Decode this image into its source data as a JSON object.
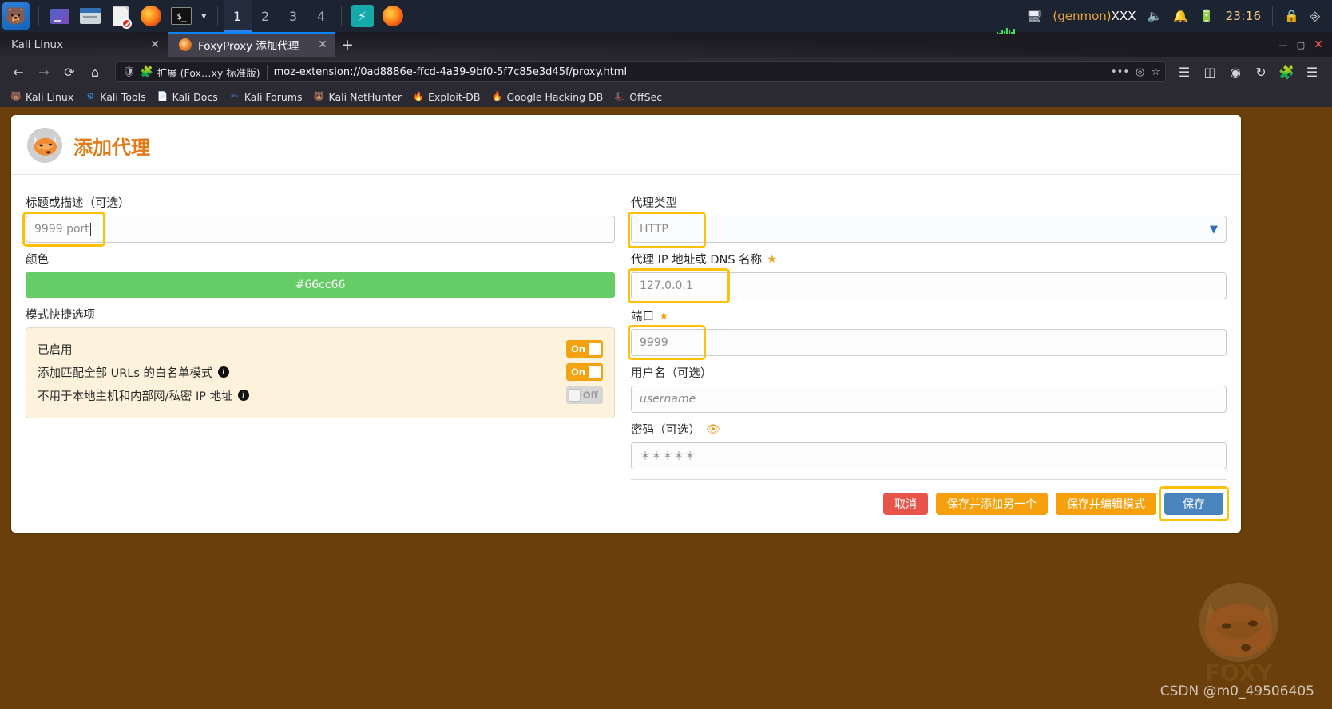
{
  "panel": {
    "launchers": [
      {
        "name": "kali-menu",
        "icon": "kali-dragon-icon"
      },
      {
        "name": "app-gradient",
        "icon": "files-icon"
      },
      {
        "name": "file-manager",
        "icon": "folder-icon"
      },
      {
        "name": "text-editor",
        "icon": "document-icon"
      },
      {
        "name": "firefox",
        "icon": "firefox-icon"
      },
      {
        "name": "terminal",
        "icon": "terminal-icon"
      }
    ],
    "workspaces": [
      "1",
      "2",
      "3",
      "4"
    ],
    "active_workspace": "1",
    "tray": {
      "genmon_prefix": "(genmon)",
      "genmon_value": "XXX",
      "clock": "23:16",
      "icons": [
        "display-icon",
        "volume-icon",
        "bell-icon",
        "battery-icon",
        "lock-icon",
        "logout-icon"
      ]
    }
  },
  "browser": {
    "tabs": [
      {
        "title": "Kali Linux",
        "active": false,
        "favicon": "none"
      },
      {
        "title": "FoxyProxy 添加代理",
        "active": true,
        "favicon": "foxyproxy-icon"
      }
    ],
    "new_tab_label": "+",
    "window_buttons": {
      "minimize": "—",
      "maximize": "▢",
      "close": "✕"
    },
    "nav": {
      "back": "←",
      "forward": "→",
      "reload": "⟳",
      "home": "⌂",
      "shield_icon": "shield-icon",
      "extension_chip": "扩展 (Fox…xy 标准版)",
      "url": "moz-extension://0ad8886e-ffcd-4a39-9bf0-5f7c85e3d45f/proxy.html",
      "page_actions": "•••",
      "pocket_icon": "pocket-icon",
      "bookmark_icon": "star-icon",
      "library_icon": "library-icon",
      "sidebar_icon": "sidebar-icon",
      "account_icon": "account-icon",
      "sync_icon": "sync-icon",
      "extensions_icon": "extensions-icon",
      "menu_icon": "hamburger-menu-icon"
    },
    "bookmarks": [
      {
        "label": "Kali Linux",
        "icon": "kali-icon",
        "color": "#2f8fd6"
      },
      {
        "label": "Kali Tools",
        "icon": "tools-icon",
        "color": "#2f8fd6"
      },
      {
        "label": "Kali Docs",
        "icon": "docs-icon",
        "color": "#cc2222"
      },
      {
        "label": "Kali Forums",
        "icon": "forums-icon",
        "color": "#2f6fd6"
      },
      {
        "label": "Kali NetHunter",
        "icon": "nethunter-icon",
        "color": "#cc2222"
      },
      {
        "label": "Exploit-DB",
        "icon": "exploitdb-icon",
        "color": "#f08a20"
      },
      {
        "label": "Google Hacking DB",
        "icon": "ghdb-icon",
        "color": "#f08a20"
      },
      {
        "label": "OffSec",
        "icon": "offsec-icon",
        "color": "#d94040"
      }
    ]
  },
  "page": {
    "header_title": "添加代理",
    "logo": "foxyproxy-fox-logo",
    "left": {
      "title_label": "标题或描述（可选）",
      "title_value": "9999 port",
      "color_label": "颜色",
      "color_value": "#66cc66",
      "shortcut_label": "模式快捷选项",
      "shortcuts": [
        {
          "label": "已启用",
          "state": "On",
          "has_info": false
        },
        {
          "label": "添加匹配全部 URLs 的白名单模式",
          "state": "On",
          "has_info": true
        },
        {
          "label": "不用于本地主机和内部网/私密 IP 地址",
          "state": "Off",
          "has_info": true
        }
      ]
    },
    "right": {
      "type_label": "代理类型",
      "type_value": "HTTP",
      "host_label": "代理 IP 地址或 DNS 名称",
      "host_value": "127.0.0.1",
      "port_label": "端口",
      "port_value": "9999",
      "username_label": "用户名（可选）",
      "username_placeholder": "username",
      "password_label": "密码（可选）",
      "password_placeholder": "＊＊＊＊＊"
    },
    "buttons": {
      "cancel": "取消",
      "save_add_another": "保存并添加另一个",
      "save_edit_patterns": "保存并编辑模式",
      "save": "保存"
    }
  },
  "watermark": "CSDN @m0_49506405"
}
